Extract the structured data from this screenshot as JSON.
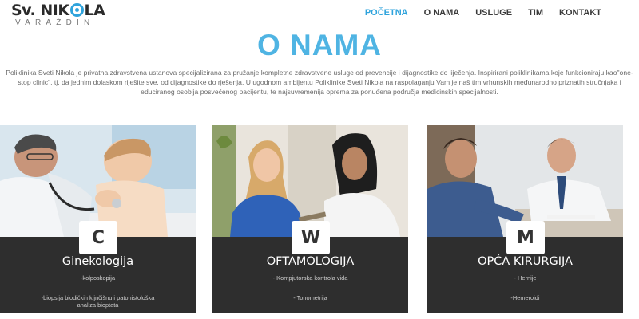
{
  "logo": {
    "main_left": "Sv. NIK",
    "main_right": "LA",
    "sub": "VARAŽDIN"
  },
  "nav": [
    {
      "label": "POČETNA",
      "active": true
    },
    {
      "label": "O NAMA",
      "active": false
    },
    {
      "label": "USLUGE",
      "active": false
    },
    {
      "label": "TIM",
      "active": false
    },
    {
      "label": "KONTAKT",
      "active": false
    }
  ],
  "page": {
    "title": "O NAMA",
    "intro": "Poliklinika Sveti Nikola je privatna zdravstvena ustanova specijalizirana za pružanje kompletne zdravstvene usluge od prevencije i dijagnostike do liječenja. Inspirirani poliklinikama koje funkcioniraju kao\"one-stop clinic\", tj. da jednim dolaskom riješite sve, od dijagnostike do rješenja. U ugodnom ambijentu Poliklinike Sveti Nikola na raspolaganju Vam je naš tim vrhunskih međunarodno priznatih stručnjaka i educiranog osoblja posvećenog pacijentu, te najsuvremenija oprema za ponuđena područja medicinskih specijalnosti."
  },
  "colors": {
    "accent": "#2ea3dc",
    "title": "#4fb4e3",
    "card_bg": "#2e2e2e"
  },
  "cards": [
    {
      "badge": "C",
      "title": "Ginekologija",
      "line1": "-kolposkopija",
      "line2": "-biopsija biodičkih kljnčišnu i patohistološka",
      "line3": "analiza bioptata"
    },
    {
      "badge": "W",
      "title": "OFTAMOLOGIJA",
      "line1": "- Kompjutorska kontrola vida",
      "line2": "- Tonometrija",
      "line3": ""
    },
    {
      "badge": "M",
      "title": "OPĆA KIRURGIJA",
      "line1": "- Hernije",
      "line2": "-Hemeroidi",
      "line3": ""
    }
  ]
}
